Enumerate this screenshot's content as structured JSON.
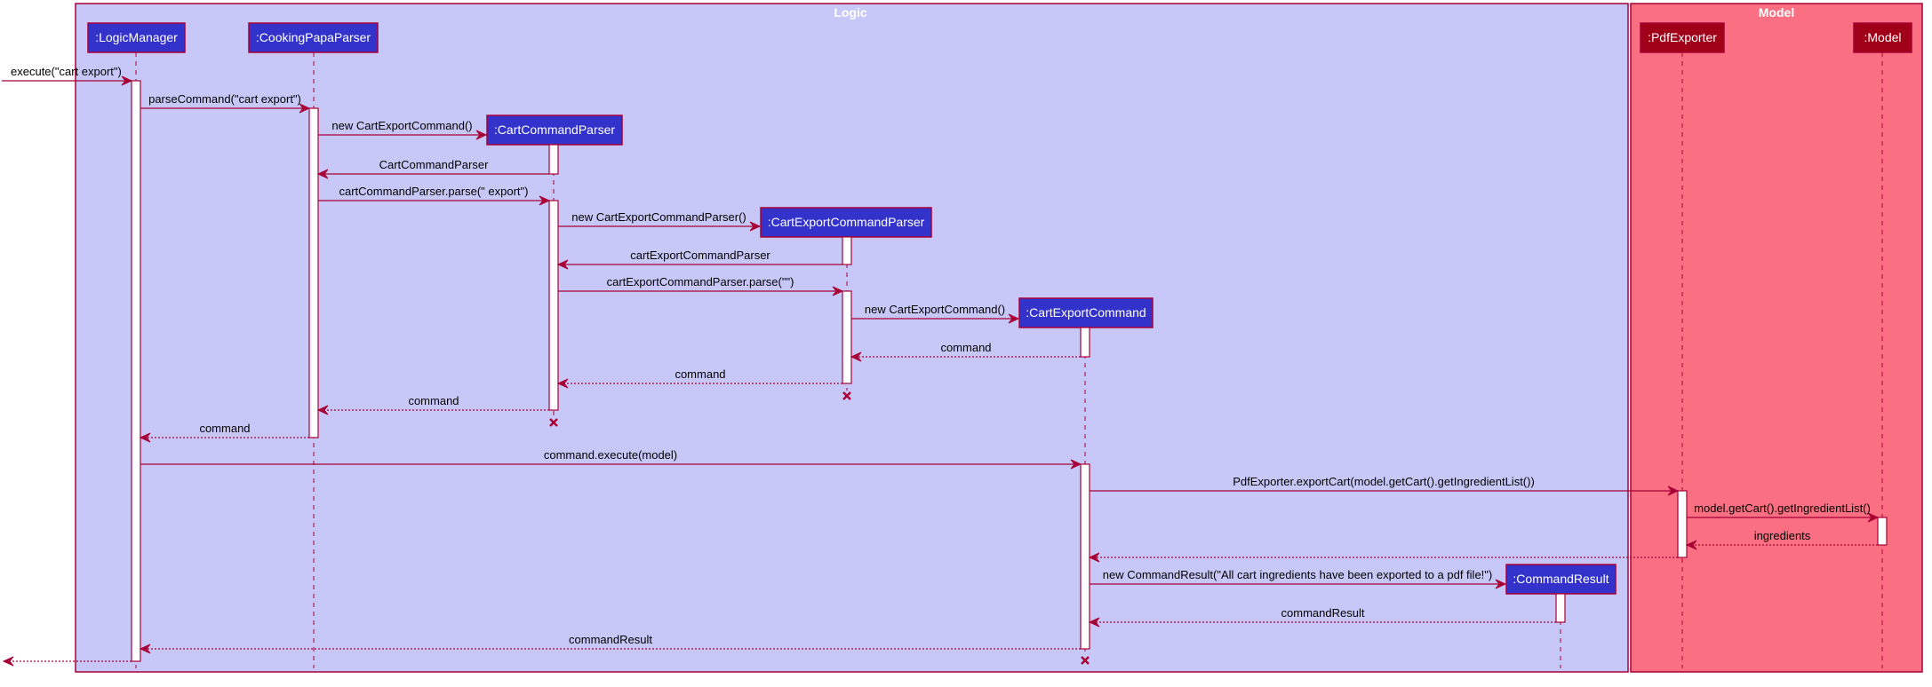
{
  "diagram": {
    "type": "sequence",
    "colors": {
      "border": "#A80036",
      "logic_frame_fill": "#C8C8F8",
      "model_frame_fill": "#FA7082",
      "logic_participant_fill": "#3333CC",
      "model_participant_fill": "#A00018",
      "participant_text": "#FFFFFF",
      "activation_fill": "#FFFFFF"
    },
    "frames": [
      {
        "id": "logic",
        "title": "Logic"
      },
      {
        "id": "model",
        "title": "Model"
      }
    ],
    "participants": [
      {
        "id": "lm",
        "label": ":LogicManager",
        "frame": "logic"
      },
      {
        "id": "cpp",
        "label": ":CookingPapaParser",
        "frame": "logic"
      },
      {
        "id": "ccp",
        "label": ":CartCommandParser",
        "frame": "logic",
        "created": true,
        "destroyed": true
      },
      {
        "id": "cecp",
        "label": ":CartExportCommandParser",
        "frame": "logic",
        "created": true,
        "destroyed": true
      },
      {
        "id": "cec",
        "label": ":CartExportCommand",
        "frame": "logic",
        "created": true,
        "destroyed": true
      },
      {
        "id": "cr",
        "label": ":CommandResult",
        "frame": "logic",
        "created": true
      },
      {
        "id": "pdf",
        "label": ":PdfExporter",
        "frame": "model"
      },
      {
        "id": "model",
        "label": ":Model",
        "frame": "model"
      }
    ],
    "messages": [
      {
        "from": "external",
        "to": "lm",
        "label": "execute(\"cart export\")",
        "kind": "call"
      },
      {
        "from": "lm",
        "to": "cpp",
        "label": "parseCommand(\"cart export\")",
        "kind": "call"
      },
      {
        "from": "cpp",
        "to": "ccp",
        "label": "new CartExportCommand()",
        "kind": "create"
      },
      {
        "from": "ccp",
        "to": "cpp",
        "label": "CartCommandParser",
        "kind": "reply-solid"
      },
      {
        "from": "cpp",
        "to": "ccp",
        "label": "cartCommandParser.parse(\" export\")",
        "kind": "call"
      },
      {
        "from": "ccp",
        "to": "cecp",
        "label": "new CartExportCommandParser()",
        "kind": "create"
      },
      {
        "from": "cecp",
        "to": "ccp",
        "label": "cartExportCommandParser",
        "kind": "reply-solid"
      },
      {
        "from": "ccp",
        "to": "cecp",
        "label": "cartExportCommandParser.parse(\"\")",
        "kind": "call"
      },
      {
        "from": "cecp",
        "to": "cec",
        "label": "new CartExportCommand()",
        "kind": "create"
      },
      {
        "from": "cec",
        "to": "cecp",
        "label": "command",
        "kind": "return"
      },
      {
        "from": "cecp",
        "to": "ccp",
        "label": "command",
        "kind": "return"
      },
      {
        "from": "ccp",
        "to": "cpp",
        "label": "command",
        "kind": "return"
      },
      {
        "from": "cpp",
        "to": "lm",
        "label": "command",
        "kind": "return"
      },
      {
        "from": "lm",
        "to": "cec",
        "label": "command.execute(model)",
        "kind": "call"
      },
      {
        "from": "cec",
        "to": "pdf",
        "label": "PdfExporter.exportCart(model.getCart().getIngredientList())",
        "kind": "call"
      },
      {
        "from": "pdf",
        "to": "model",
        "label": "model.getCart().getIngredientList()",
        "kind": "call"
      },
      {
        "from": "model",
        "to": "pdf",
        "label": "ingredients",
        "kind": "return"
      },
      {
        "from": "pdf",
        "to": "cec",
        "label": "",
        "kind": "return"
      },
      {
        "from": "cec",
        "to": "cr",
        "label": "new CommandResult(\"All cart ingredients have been exported to a pdf file!\")",
        "kind": "create"
      },
      {
        "from": "cr",
        "to": "cec",
        "label": "commandResult",
        "kind": "return"
      },
      {
        "from": "cec",
        "to": "lm",
        "label": "commandResult",
        "kind": "return"
      },
      {
        "from": "lm",
        "to": "external",
        "label": "",
        "kind": "return"
      }
    ]
  }
}
